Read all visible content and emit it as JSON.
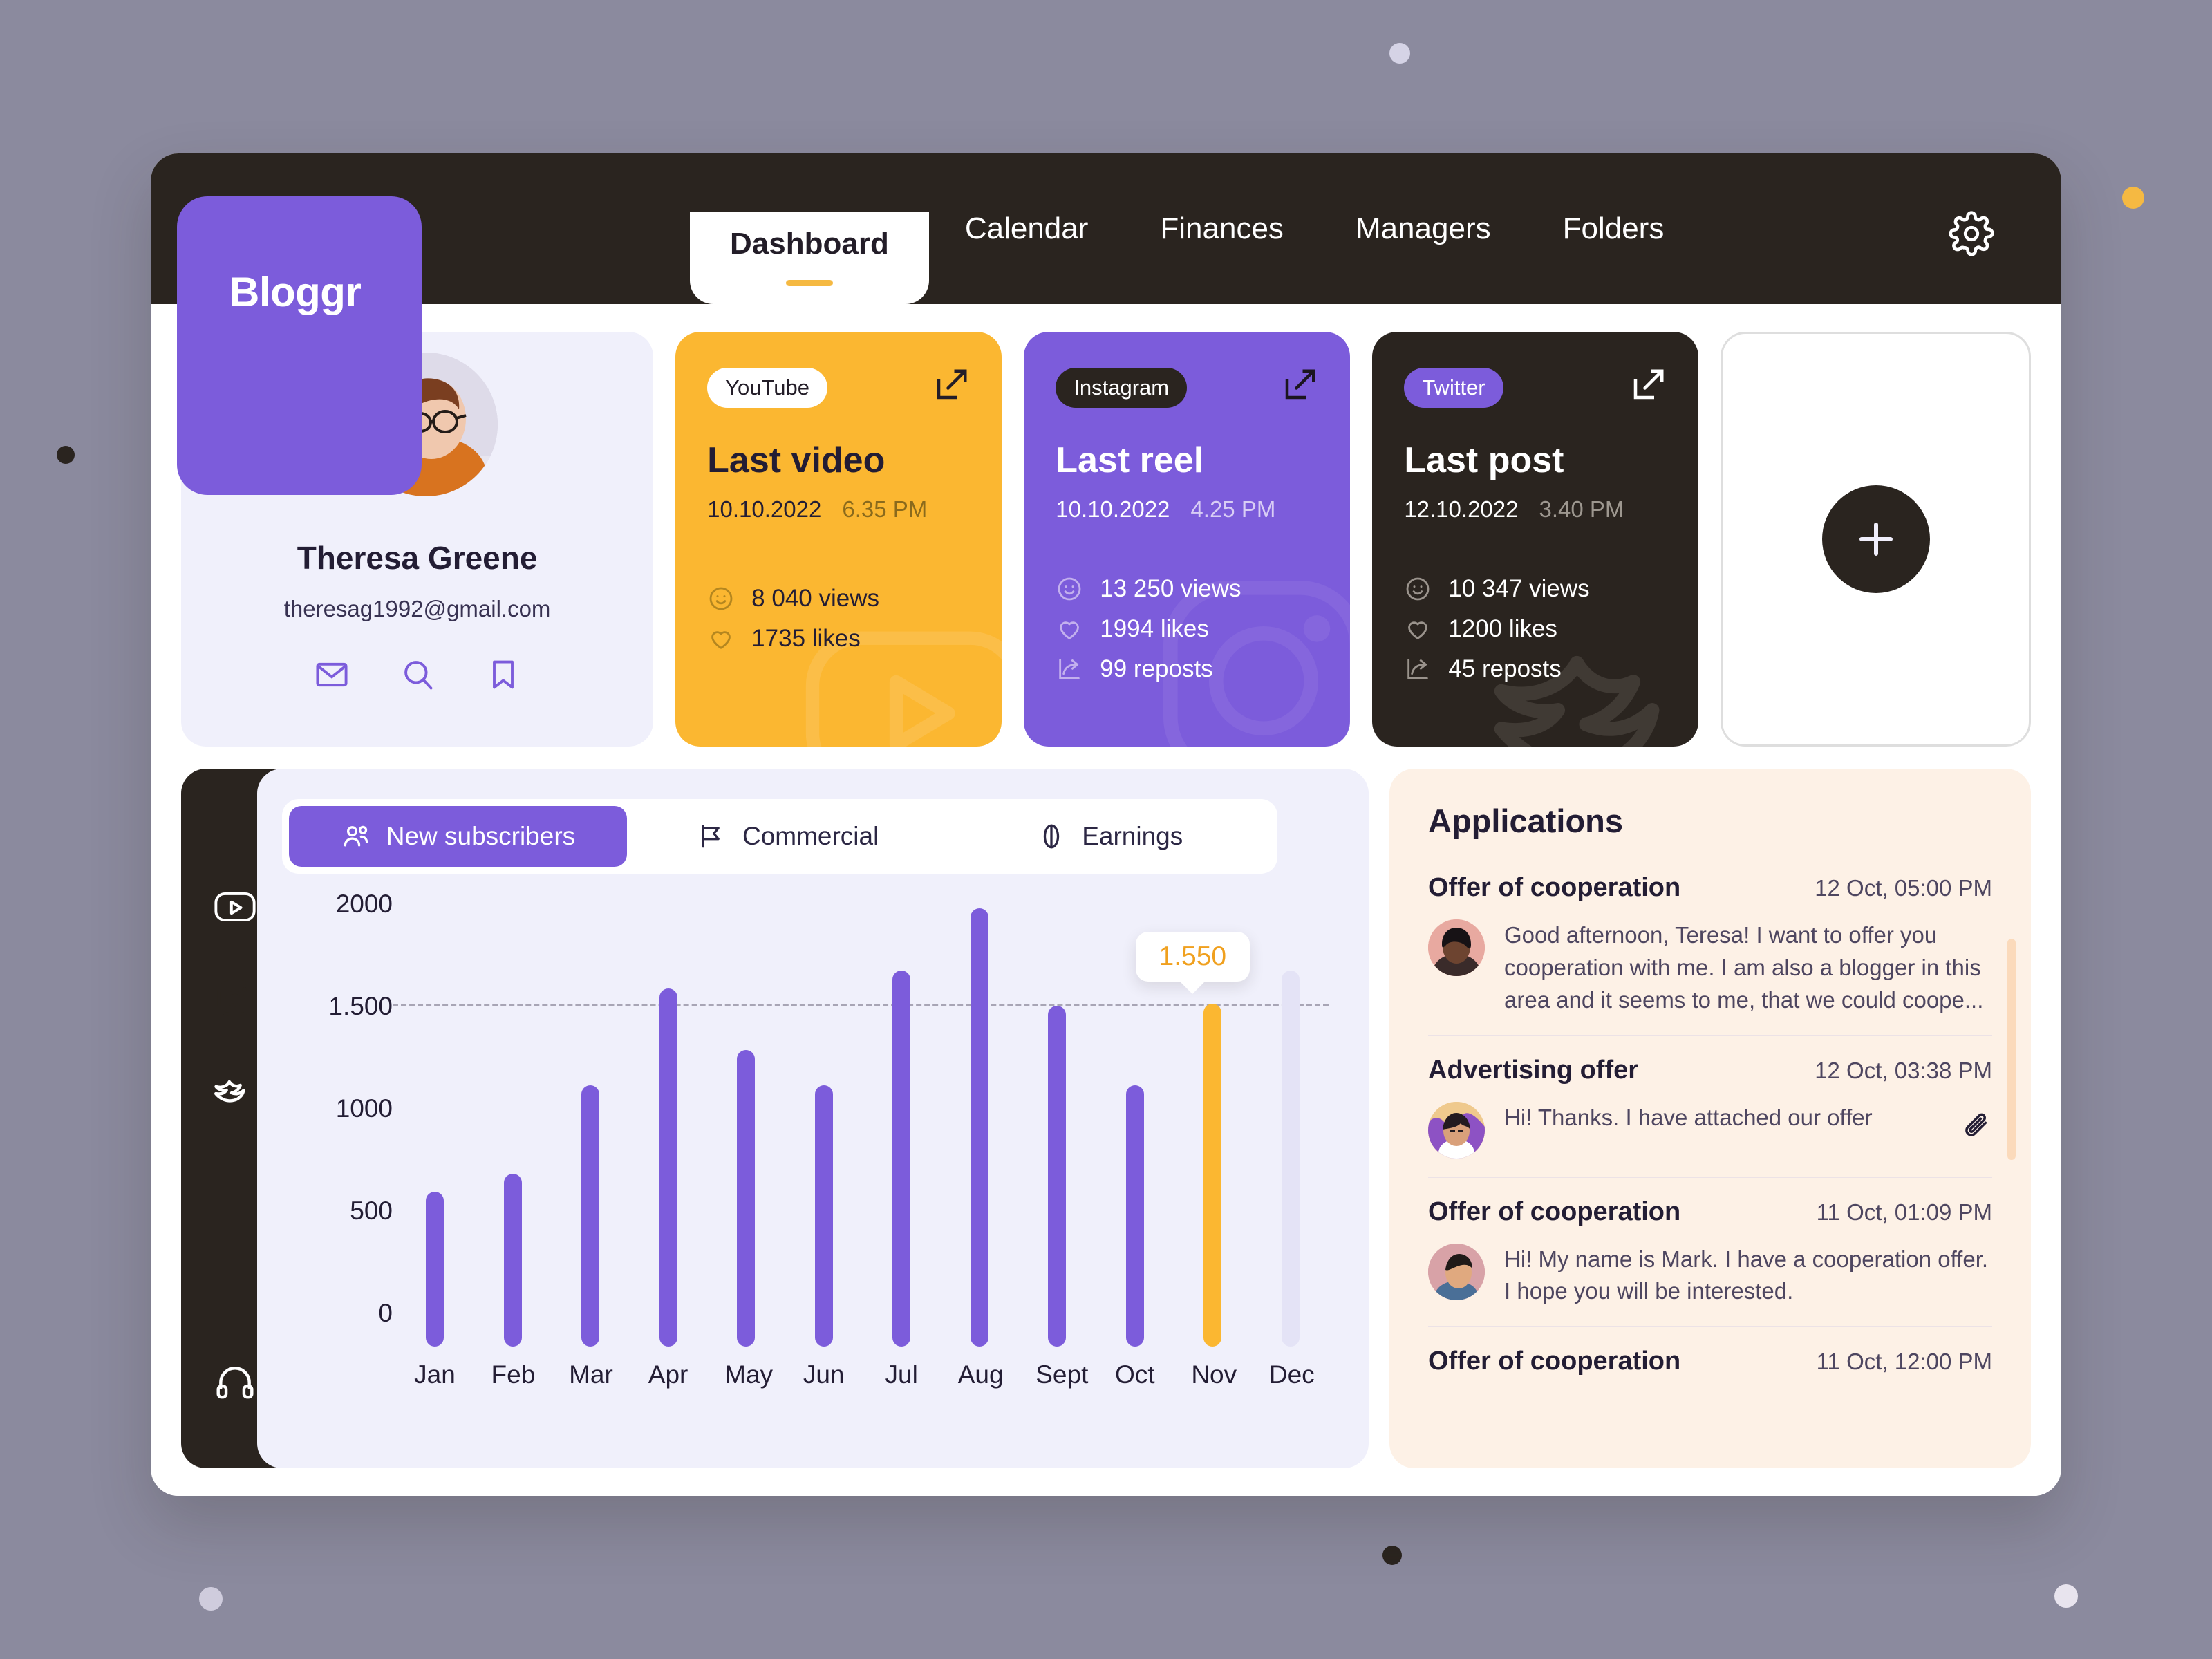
{
  "brand": {
    "name": "Bloggr"
  },
  "topbar": {
    "tabs": [
      {
        "label": "Dashboard",
        "active": true
      },
      {
        "label": "Calendar",
        "active": false
      },
      {
        "label": "Finances",
        "active": false
      },
      {
        "label": "Managers",
        "active": false
      },
      {
        "label": "Folders",
        "active": false
      }
    ],
    "settings_icon": "gear-icon"
  },
  "profile": {
    "name": "Theresa Greene",
    "email": "theresag1992@gmail.com",
    "icons": [
      "mail-icon",
      "search-icon",
      "bookmark-icon"
    ]
  },
  "social_cards": [
    {
      "platform": "YouTube",
      "title": "Last video",
      "date": "10.10.2022",
      "time": "6.35 PM",
      "stats": [
        {
          "icon": "smiley-icon",
          "value": "8 040 views"
        },
        {
          "icon": "heart-icon",
          "value": "1735 likes"
        }
      ],
      "accent": "#fbb731"
    },
    {
      "platform": "Instagram",
      "title": "Last reel",
      "date": "10.10.2022",
      "time": "4.25 PM",
      "stats": [
        {
          "icon": "smiley-icon",
          "value": "13 250 views"
        },
        {
          "icon": "heart-icon",
          "value": "1994 likes"
        },
        {
          "icon": "repost-icon",
          "value": "99 reposts"
        }
      ],
      "accent": "#7c5cdb"
    },
    {
      "platform": "Twitter",
      "title": "Last post",
      "date": "12.10.2022",
      "time": "3.40 PM",
      "stats": [
        {
          "icon": "smiley-icon",
          "value": "10 347 views"
        },
        {
          "icon": "heart-icon",
          "value": "1200 likes"
        },
        {
          "icon": "repost-icon",
          "value": "45 reposts"
        }
      ],
      "accent": "#2a241f"
    }
  ],
  "add_card": {
    "icon": "plus-icon"
  },
  "rail": {
    "items": [
      {
        "icon": "youtube-icon",
        "active": false
      },
      {
        "icon": "instagram-icon",
        "active": true
      },
      {
        "icon": "twitter-icon",
        "active": false
      },
      {
        "icon": "headphones-icon",
        "active": false
      }
    ]
  },
  "chart_panel": {
    "toggles": [
      {
        "label": "New subscribers",
        "icon": "users-icon",
        "active": true
      },
      {
        "label": "Commercial",
        "icon": "megaphone-icon",
        "active": false
      },
      {
        "label": "Earnings",
        "icon": "coin-icon",
        "active": false
      }
    ]
  },
  "chart_data": {
    "type": "bar",
    "title": "New subscribers",
    "xlabel": "",
    "ylabel": "",
    "categories": [
      "Jan",
      "Feb",
      "Mar",
      "Apr",
      "May",
      "Jun",
      "Jul",
      "Aug",
      "Sept",
      "Oct",
      "Nov",
      "Dec"
    ],
    "values": [
      700,
      780,
      1180,
      1620,
      1340,
      1180,
      1700,
      1980,
      1540,
      1180,
      1550,
      0
    ],
    "ytick_labels": [
      "0",
      "500",
      "1000",
      "1.500",
      "2000"
    ],
    "ytick_values": [
      0,
      500,
      1000,
      1500,
      2000
    ],
    "ylim": [
      0,
      2000
    ],
    "grid": false,
    "legend": "none",
    "reference_line": {
      "value": 1550,
      "style": "dashed",
      "color": "#a8a5b5"
    },
    "highlight": {
      "category": "Nov",
      "value": 1550,
      "label": "1.550",
      "color": "#fbb731"
    },
    "placeholder_bar": {
      "category": "Dec",
      "color": "#e4e3f6"
    },
    "bar_color": "#7c5cdb"
  },
  "applications": {
    "title": "Applications",
    "items": [
      {
        "subject": "Offer of cooperation",
        "time": "12 Oct, 05:00 PM",
        "message": "Good afternoon, Teresa! I want to offer you cooperation with me. I am also a blogger in this area and it seems to me, that we could coope...",
        "avatar_tint": "#e8a9a0",
        "attachment": false
      },
      {
        "subject": "Advertising offer",
        "time": "12 Oct, 03:38 PM",
        "message": "Hi! Thanks. I have attached our offer",
        "avatar_tint": "#f0c98b",
        "attachment": true
      },
      {
        "subject": "Offer of cooperation",
        "time": "11 Oct, 01:09 PM",
        "message": "Hi! My name is Mark. I have a cooperation offer. I hope you will be interested.",
        "avatar_tint": "#d9a3a8",
        "attachment": false
      },
      {
        "subject": "Offer of cooperation",
        "time": "11 Oct, 12:00 PM",
        "message": "",
        "avatar_tint": "#cbb6d8",
        "attachment": false
      }
    ]
  }
}
